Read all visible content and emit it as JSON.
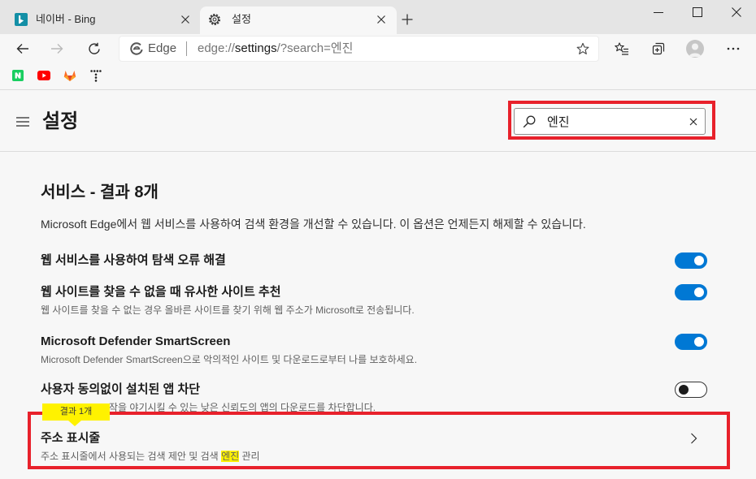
{
  "browser": {
    "tabs": [
      {
        "title": "네이버 - Bing",
        "icon": "bing-icon"
      },
      {
        "title": "설정",
        "icon": "gear-icon"
      }
    ],
    "address": {
      "site_label": "Edge",
      "url_scheme": "edge://",
      "url_host": "settings",
      "url_rest": "/?search=엔진"
    },
    "bookmarks": [
      "naver-icon",
      "youtube-icon",
      "gitlab-icon",
      "t-dots-icon"
    ],
    "toolbar_icons": [
      "back-arrow-icon",
      "forward-arrow-icon",
      "refresh-icon",
      "add-favorite-star-icon",
      "favorites-icon",
      "collections-icon",
      "profile-avatar-icon",
      "more-icon"
    ],
    "window_icons": [
      "minimize-icon",
      "maximize-icon",
      "close-icon"
    ]
  },
  "settings": {
    "title": "설정",
    "search": {
      "value": "엔진"
    }
  },
  "section": {
    "heading": "서비스 - 결과 8개",
    "description": "Microsoft Edge에서 웹 서비스를 사용하여 검색 환경을 개선할 수 있습니다. 이 옵션은 언제든지 해제할 수 있습니다.",
    "items": [
      {
        "title": "웹 서비스를 사용하여 탐색 오류 해결",
        "toggle_on": true
      },
      {
        "title": "웹 사이트를 찾을 수 없을 때 유사한 사이트 추천",
        "subtitle": "웹 사이트를 찾을 수 없는 경우 올바른 사이트를 찾기 위해 웹 주소가 Microsoft로 전송됩니다.",
        "toggle_on": true
      },
      {
        "title": "Microsoft Defender SmartScreen",
        "subtitle": "Microsoft Defender SmartScreen으로 악의적인 사이트 및 다운로드로부터 나를 보호하세요.",
        "toggle_on": true
      },
      {
        "title": "사용자 동의없이 설치된 앱 차단",
        "subtitle": "작을 야기시킬 수 있는 낮은 신뢰도의 앱의 다운로드를 차단합니다.",
        "toggle_on": false
      },
      {
        "title": "주소 표시줄",
        "subtitle_before": "주소 표시줄에서 사용되는 검색 제안 및 검색 ",
        "subtitle_match": "엔진",
        "subtitle_after": " 관리"
      }
    ]
  },
  "search_result_tooltip": "결과 1개",
  "colors": {
    "accent": "#0078d4",
    "match_highlight": "#fff200",
    "annotation_red": "#e8212b",
    "tooltip": "#fff200"
  }
}
